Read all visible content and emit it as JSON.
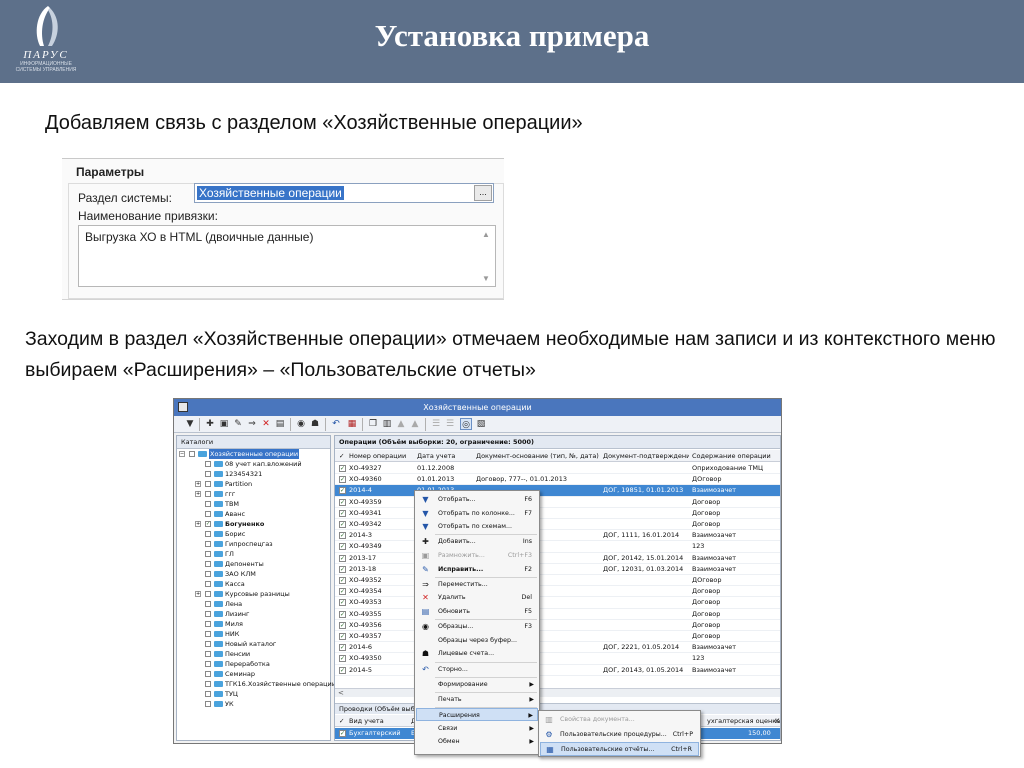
{
  "header": {
    "title": "Установка примера",
    "logo_name": "ПАРУС",
    "logo_sub": "ИНФОРМАЦИОННЫЕ СИСТЕМЫ УПРАВЛЕНИЯ",
    "bg_color": "#5d708a"
  },
  "paragraph1": "Добавляем связь с разделом «Хозяйственные операции»",
  "paragraph2": "Заходим в раздел «Хозяйственные операции» отмечаем необходимые нам записи и из контекстного меню выбираем «Расширения» – «Пользовательские отчеты»",
  "params": {
    "heading": "Параметры",
    "section_label": "Раздел системы:",
    "section_value": "Хозяйственные операции",
    "browse_label": "...",
    "link_label": "Наименование привязки:",
    "link_value": "Выгрузка ХО в HTML (двоичные данные)"
  },
  "window": {
    "title": "Хозяйственные операции",
    "catalogs_header": "Каталоги",
    "tree": [
      {
        "label": "Хозяйственные операции",
        "level": 0,
        "expander": "−",
        "checked": false,
        "selected": true,
        "bold": false
      },
      {
        "label": "08 учет кап.вложений",
        "level": 1,
        "expander": "",
        "checked": false,
        "selected": false,
        "bold": false
      },
      {
        "label": "123454321",
        "level": 1,
        "expander": "",
        "checked": false,
        "selected": false,
        "bold": false
      },
      {
        "label": "Partition",
        "level": 1,
        "expander": "+",
        "checked": false,
        "selected": false,
        "bold": false
      },
      {
        "label": "ггг",
        "level": 1,
        "expander": "+",
        "checked": false,
        "selected": false,
        "bold": false
      },
      {
        "label": "ТВМ",
        "level": 1,
        "expander": "",
        "checked": false,
        "selected": false,
        "bold": false
      },
      {
        "label": "Аванс",
        "level": 1,
        "expander": "",
        "checked": false,
        "selected": false,
        "bold": false
      },
      {
        "label": "Богуненко",
        "level": 1,
        "expander": "+",
        "checked": true,
        "selected": false,
        "bold": true
      },
      {
        "label": "Борис",
        "level": 1,
        "expander": "",
        "checked": false,
        "selected": false,
        "bold": false
      },
      {
        "label": "Гипроспецгаз",
        "level": 1,
        "expander": "",
        "checked": false,
        "selected": false,
        "bold": false
      },
      {
        "label": "ГЛ",
        "level": 1,
        "expander": "",
        "checked": false,
        "selected": false,
        "bold": false
      },
      {
        "label": "Депоненты",
        "level": 1,
        "expander": "",
        "checked": false,
        "selected": false,
        "bold": false
      },
      {
        "label": "ЗАО КЛМ",
        "level": 1,
        "expander": "",
        "checked": false,
        "selected": false,
        "bold": false
      },
      {
        "label": "Касса",
        "level": 1,
        "expander": "",
        "checked": false,
        "selected": false,
        "bold": false
      },
      {
        "label": "Курсовые разницы",
        "level": 1,
        "expander": "+",
        "checked": false,
        "selected": false,
        "bold": false
      },
      {
        "label": "Лена",
        "level": 1,
        "expander": "",
        "checked": false,
        "selected": false,
        "bold": false
      },
      {
        "label": "Лизинг",
        "level": 1,
        "expander": "",
        "checked": false,
        "selected": false,
        "bold": false
      },
      {
        "label": "Миля",
        "level": 1,
        "expander": "",
        "checked": false,
        "selected": false,
        "bold": false
      },
      {
        "label": "НИК",
        "level": 1,
        "expander": "",
        "checked": false,
        "selected": false,
        "bold": false
      },
      {
        "label": "Новый каталог",
        "level": 1,
        "expander": "",
        "checked": false,
        "selected": false,
        "bold": false
      },
      {
        "label": "Пенсии",
        "level": 1,
        "expander": "",
        "checked": false,
        "selected": false,
        "bold": false
      },
      {
        "label": "Переработка",
        "level": 1,
        "expander": "",
        "checked": false,
        "selected": false,
        "bold": false
      },
      {
        "label": "Семинар",
        "level": 1,
        "expander": "",
        "checked": false,
        "selected": false,
        "bold": false
      },
      {
        "label": "ТГК16.Хозяйственные операции",
        "level": 1,
        "expander": "",
        "checked": false,
        "selected": false,
        "bold": false
      },
      {
        "label": "ТУЦ",
        "level": 1,
        "expander": "",
        "checked": false,
        "selected": false,
        "bold": false
      },
      {
        "label": "УК",
        "level": 1,
        "expander": "",
        "checked": false,
        "selected": false,
        "bold": false
      }
    ],
    "grid_header": "Операции (Объём выборки: 20, ограничение: 5000)",
    "columns": [
      "Номер операции",
      "Дата учета",
      "Документ-основание (тип, №, дата)",
      "Документ-подтверждени",
      "Содержание операции"
    ],
    "rows": [
      {
        "num": "ХО-49327",
        "date": "01.12.2008",
        "base": "",
        "confirm": "",
        "content": "Оприходование ТМЦ"
      },
      {
        "num": "ХО-49360",
        "date": "01.01.2013",
        "base": "Договор, 777--, 01.01.2013",
        "confirm": "",
        "content": "ДОговор"
      },
      {
        "num": "2014-4",
        "date": "01.01.2013",
        "base": "",
        "confirm": "ДОГ, 19851, 01.01.2013",
        "content": "Взаимозачет"
      },
      {
        "num": "ХО-49359",
        "date": "",
        "base": "1.2013",
        "confirm": "",
        "content": "Договор"
      },
      {
        "num": "ХО-49341",
        "date": "",
        "base": "1.01.2014",
        "confirm": "",
        "content": "Договор"
      },
      {
        "num": "ХО-49342",
        "date": "",
        "base": "1.01.2014",
        "confirm": "",
        "content": "Договор"
      },
      {
        "num": "2014-3",
        "date": "",
        "base": "",
        "confirm": "ДОГ, 1111, 16.01.2014",
        "content": "Взаимозачет"
      },
      {
        "num": "ХО-49349",
        "date": "",
        "base": "",
        "confirm": "",
        "content": "123"
      },
      {
        "num": "2013-17",
        "date": "",
        "base": "",
        "confirm": "ДОГ, 20142, 15.01.2014",
        "content": "Взаимозачет"
      },
      {
        "num": "2013-18",
        "date": "",
        "base": "",
        "confirm": "ДОГ, 12031, 01.03.2014",
        "content": "Взаимозачет"
      },
      {
        "num": "ХО-49352",
        "date": "",
        "base": "3.2014",
        "confirm": "",
        "content": "ДОговор"
      },
      {
        "num": "ХО-49354",
        "date": "",
        "base": "1.04.2014",
        "confirm": "",
        "content": "Договор"
      },
      {
        "num": "ХО-49353",
        "date": "",
        "base": "4.2014",
        "confirm": "",
        "content": "Договор"
      },
      {
        "num": "ХО-49355",
        "date": "",
        "base": "1.04.2014",
        "confirm": "",
        "content": "Договор"
      },
      {
        "num": "ХО-49356",
        "date": "",
        "base": "1.04.2014",
        "confirm": "",
        "content": "Договор"
      },
      {
        "num": "ХО-49357",
        "date": "",
        "base": "1.04.2014",
        "confirm": "",
        "content": "Договор"
      },
      {
        "num": "2014-6",
        "date": "",
        "base": "",
        "confirm": "ДОГ, 2221, 01.05.2014",
        "content": "Взаимозачет"
      },
      {
        "num": "ХО-49350",
        "date": "",
        "base": "1.05.2014",
        "confirm": "",
        "content": "123"
      },
      {
        "num": "2014-5",
        "date": "",
        "base": "",
        "confirm": "ДОГ, 20143, 01.05.2014",
        "content": "Взаимозачет"
      }
    ],
    "scroll_left": "<",
    "sub_header": "Проводки (Объём выбор",
    "sub_columns": {
      "left": "Вид учета",
      "mid": "Д",
      "right": "ухгалтерская оценка)",
      "far": "К"
    },
    "sub_row": {
      "left": "Бухгалтерский",
      "mid": "Б",
      "value": "150,00"
    }
  },
  "context_menu": [
    {
      "label": "Отобрать...",
      "shortcut": "F6",
      "icon": "filter-icon",
      "glyph": "▼",
      "disabled": false,
      "arrow": false,
      "sep_after": false
    },
    {
      "label": "Отобрать по колонке...",
      "shortcut": "F7",
      "icon": "filter-column-icon",
      "glyph": "▼",
      "disabled": false,
      "arrow": false,
      "sep_after": false
    },
    {
      "label": "Отобрать по схемам...",
      "shortcut": "",
      "icon": "filter-scheme-icon",
      "glyph": "▼",
      "disabled": false,
      "arrow": false,
      "sep_after": true
    },
    {
      "label": "Добавить...",
      "shortcut": "Ins",
      "icon": "add-icon",
      "glyph": "✚",
      "disabled": false,
      "arrow": false,
      "sep_after": false
    },
    {
      "label": "Размножить...",
      "shortcut": "Ctrl+F3",
      "icon": "duplicate-icon",
      "glyph": "▣",
      "disabled": true,
      "arrow": false,
      "sep_after": false
    },
    {
      "label": "Исправить...",
      "shortcut": "F2",
      "icon": "edit-icon",
      "glyph": "✎",
      "disabled": false,
      "arrow": false,
      "sep_after": true,
      "bold": true
    },
    {
      "label": "Переместить...",
      "shortcut": "",
      "icon": "move-icon",
      "glyph": "⇒",
      "disabled": false,
      "arrow": false,
      "sep_after": false
    },
    {
      "label": "Удалить",
      "shortcut": "Del",
      "icon": "delete-icon",
      "glyph": "✕",
      "disabled": false,
      "arrow": false,
      "sep_after": false
    },
    {
      "label": "Обновить",
      "shortcut": "F5",
      "icon": "refresh-icon",
      "glyph": "▤",
      "disabled": false,
      "arrow": false,
      "sep_after": true
    },
    {
      "label": "Образцы...",
      "shortcut": "F3",
      "icon": "samples-icon",
      "glyph": "◉",
      "disabled": false,
      "arrow": false,
      "sep_after": false
    },
    {
      "label": "Образцы через буфер...",
      "shortcut": "",
      "icon": "",
      "glyph": "",
      "disabled": false,
      "arrow": false,
      "sep_after": false
    },
    {
      "label": "Лицевые счета...",
      "shortcut": "",
      "icon": "accounts-icon",
      "glyph": "☗",
      "disabled": false,
      "arrow": false,
      "sep_after": true
    },
    {
      "label": "Сторно...",
      "shortcut": "",
      "icon": "storno-icon",
      "glyph": "↶",
      "disabled": false,
      "arrow": false,
      "sep_after": true
    },
    {
      "label": "Формирование",
      "shortcut": "",
      "icon": "",
      "glyph": "",
      "disabled": false,
      "arrow": true,
      "sep_after": true
    },
    {
      "label": "Печать",
      "shortcut": "",
      "icon": "",
      "glyph": "",
      "disabled": false,
      "arrow": true,
      "sep_after": true
    },
    {
      "label": "Расширения",
      "shortcut": "",
      "icon": "",
      "glyph": "",
      "disabled": false,
      "arrow": true,
      "sep_after": false,
      "hot": true
    },
    {
      "label": "Связи",
      "shortcut": "",
      "icon": "",
      "glyph": "",
      "disabled": false,
      "arrow": true,
      "sep_after": false
    },
    {
      "label": "Обмен",
      "shortcut": "",
      "icon": "",
      "glyph": "",
      "disabled": false,
      "arrow": true,
      "sep_after": false
    }
  ],
  "submenu": [
    {
      "label": "Свойства документа...",
      "shortcut": "",
      "icon": "doc-properties-icon",
      "glyph": "▥",
      "disabled": true
    },
    {
      "label": "Пользовательские процедуры...",
      "shortcut": "Ctrl+P",
      "icon": "user-procedures-icon",
      "glyph": "⚙",
      "disabled": false
    },
    {
      "label": "Пользовательские отчёты...",
      "shortcut": "Ctrl+R",
      "icon": "user-reports-icon",
      "glyph": "▦",
      "disabled": false,
      "hot": true
    }
  ]
}
